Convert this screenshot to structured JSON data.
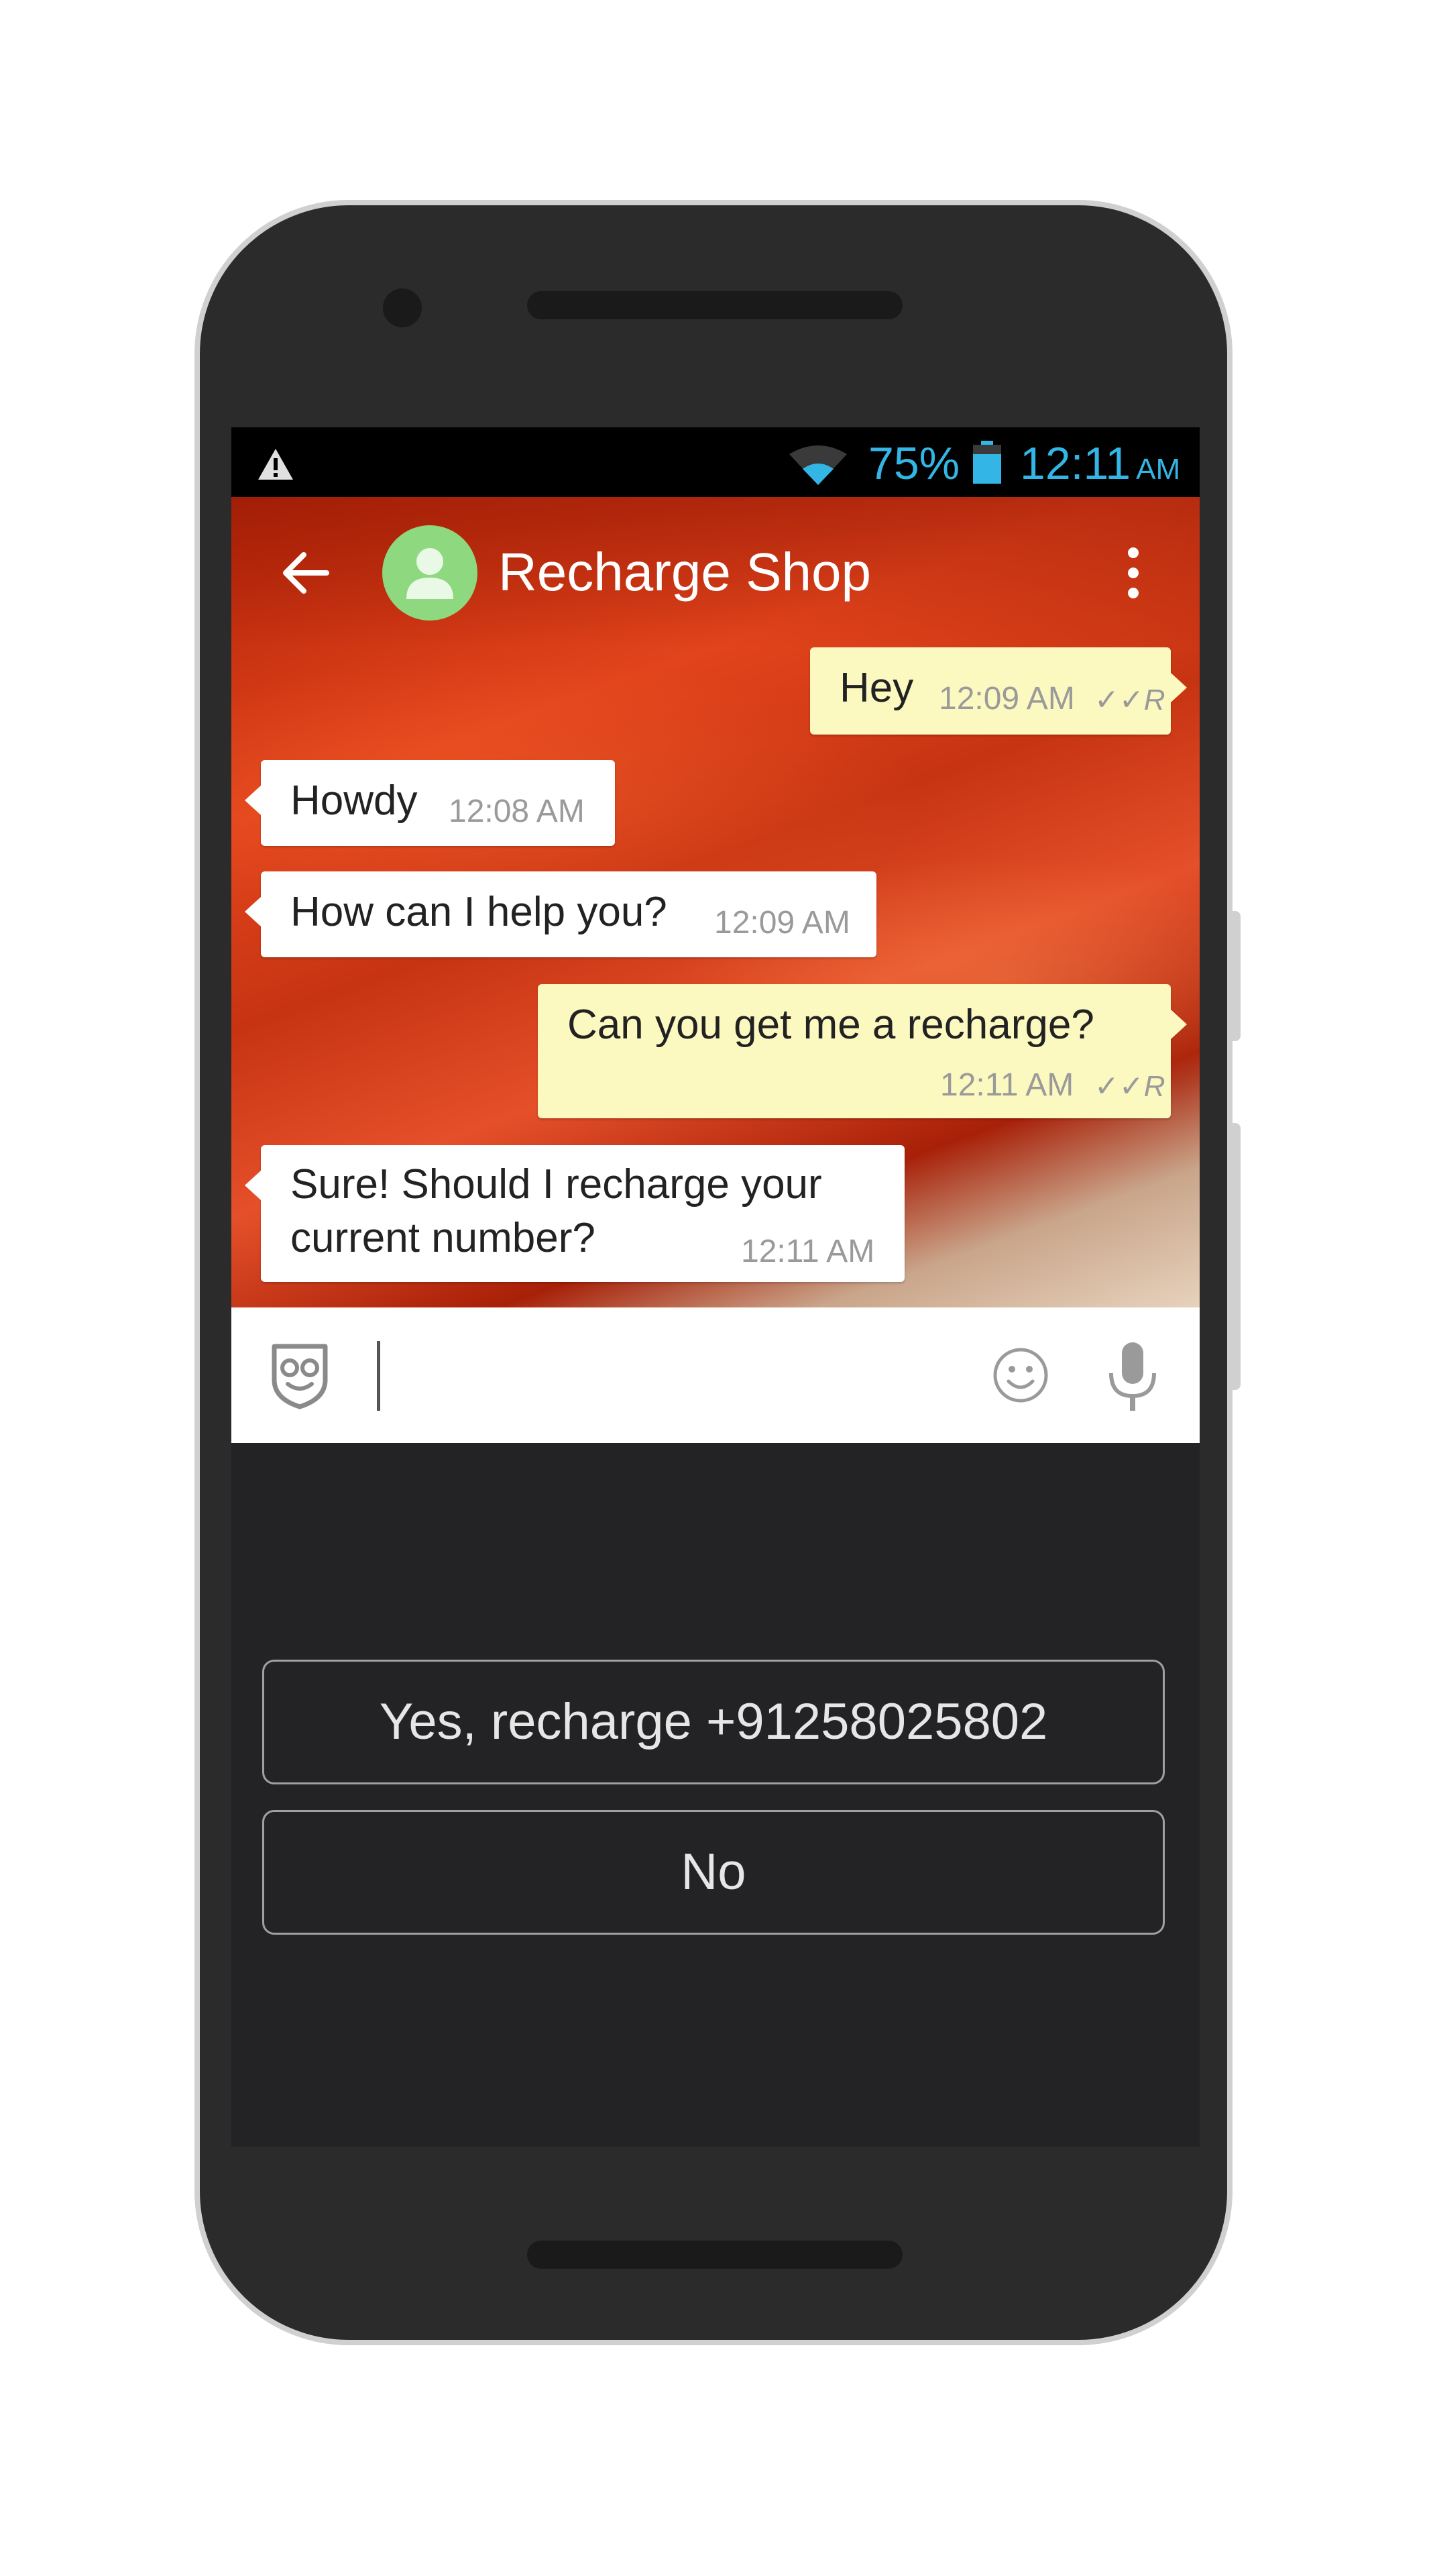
{
  "status_bar": {
    "battery_percent": "75%",
    "time": "12:11",
    "ampm": "AM",
    "accent_color": "#33b5e5"
  },
  "app_bar": {
    "title": "Recharge Shop"
  },
  "messages": [
    {
      "direction": "out",
      "text": "Hey",
      "time": "12:09 AM",
      "receipt": "✓✓R"
    },
    {
      "direction": "in",
      "text": "Howdy",
      "time": "12:08 AM"
    },
    {
      "direction": "in",
      "text": "How can I help you?",
      "time": "12:09 AM"
    },
    {
      "direction": "out",
      "text": "Can you get me a recharge?",
      "time": "12:11 AM",
      "receipt": "✓✓R"
    },
    {
      "direction": "in",
      "text_line1": "Sure! Should I recharge your",
      "text_line2": "current number?",
      "time": "12:11 AM"
    }
  ],
  "quick_replies": {
    "yes_label": "Yes, recharge +91258025802",
    "no_label": "No"
  },
  "colors": {
    "outgoing_bubble": "#fbf8c0",
    "incoming_bubble": "#ffffff",
    "avatar": "#8ed97f",
    "keyboard_area": "#232325"
  },
  "icons": [
    "warning-icon",
    "wifi-icon",
    "battery-icon",
    "back-arrow-icon",
    "contact-avatar-icon",
    "overflow-menu-icon",
    "bot-icon",
    "emoji-icon",
    "mic-icon"
  ]
}
